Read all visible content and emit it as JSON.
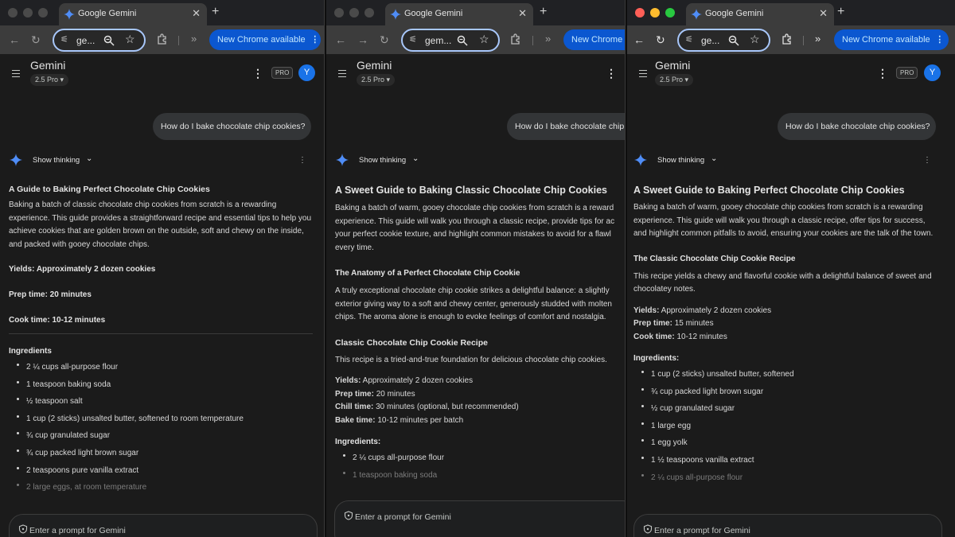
{
  "windows": [
    {
      "tab_title": "Google Gemini",
      "omnibox_text": "ge...",
      "update_label": "New Chrome available",
      "app_title": "Gemini",
      "model": "2.5 Pro",
      "pro_badge": "PRO",
      "avatar_initial": "Y",
      "user_message": "How do I bake chocolate chip cookies?",
      "show_thinking": "Show thinking",
      "heading": "A Guide to Baking Perfect Chocolate Chip Cookies",
      "intro": "Baking a batch of classic chocolate chip cookies from scratch is a rewarding experience. This guide provides a straightforward recipe and essential tips to help you achieve cookies that are golden brown on the outside, soft and chewy on the inside, and packed with gooey chocolate chips.",
      "yields": "Yields: Approximately 2 dozen cookies",
      "prep": "Prep time: 20 minutes",
      "cook": "Cook time: 10-12 minutes",
      "ingredients_heading": "Ingredients",
      "ingredients": [
        "2 ¼ cups all-purpose flour",
        "1 teaspoon baking soda",
        "½ teaspoon salt",
        "1 cup (2 sticks) unsalted butter, softened to room temperature",
        "¾ cup granulated sugar",
        "¾ cup packed light brown sugar",
        "2 teaspoons pure vanilla extract",
        "2 large eggs, at room temperature"
      ],
      "prompt_placeholder": "Enter a prompt for Gemini"
    },
    {
      "tab_title": "Google Gemini",
      "omnibox_text": "gem...",
      "update_label": "New Chrome",
      "app_title": "Gemini",
      "model": "2.5 Pro",
      "user_message": "How do I bake chocolate chip",
      "show_thinking": "Show thinking",
      "heading": "A Sweet Guide to Baking Classic Chocolate Chip Cookies",
      "intro_lines": [
        "Baking a batch of warm, gooey chocolate chip cookies from scratch is a reward",
        "experience. This guide will walk you through a classic recipe, provide tips for ac",
        "your perfect cookie texture, and highlight common mistakes to avoid for a flawl",
        "every time."
      ],
      "anatomy_heading": "The Anatomy of a Perfect Chocolate Chip Cookie",
      "anatomy_lines": [
        "A truly exceptional chocolate chip cookie strikes a delightful balance: a slightly",
        "exterior giving way to a soft and chewy center, generously studded with molten",
        "chips. The aroma alone is enough to evoke feelings of comfort and nostalgia."
      ],
      "recipe_heading": "Classic Chocolate Chip Cookie Recipe",
      "recipe_intro": "This recipe is a tried-and-true foundation for delicious chocolate chip cookies.",
      "yields_label": "Yields:",
      "yields_value": "Approximately 2 dozen cookies",
      "prep_label": "Prep time:",
      "prep_value": "20 minutes",
      "chill_label": "Chill time:",
      "chill_value": "30 minutes (optional, but recommended)",
      "bake_label": "Bake time:",
      "bake_value": "10-12 minutes per batch",
      "ingredients_heading": "Ingredients:",
      "ingredients": [
        "2 ¼ cups all-purpose flour",
        "1 teaspoon baking soda"
      ],
      "prompt_placeholder": "Enter a prompt for Gemini"
    },
    {
      "tab_title": "Google Gemini",
      "omnibox_text": "ge...",
      "update_label": "New Chrome available",
      "app_title": "Gemini",
      "model": "2.5 Pro",
      "pro_badge": "PRO",
      "avatar_initial": "Y",
      "user_message": "How do I bake chocolate chip cookies?",
      "show_thinking": "Show thinking",
      "heading": "A Sweet Guide to Baking Perfect Chocolate Chip Cookies",
      "intro": "Baking a batch of warm, gooey chocolate chip cookies from scratch is a rewarding experience. This guide will walk you through a classic recipe, offer tips for success, and highlight common pitfalls to avoid, ensuring your cookies are the talk of the town.",
      "recipe_heading": "The Classic Chocolate Chip Cookie Recipe",
      "recipe_intro": "This recipe yields a chewy and flavorful cookie with a delightful balance of sweet and chocolatey notes.",
      "yields_label": "Yields:",
      "yields_value": "Approximately 2 dozen cookies",
      "prep_label": "Prep time:",
      "prep_value": "15 minutes",
      "cook_label": "Cook time:",
      "cook_value": "10-12 minutes",
      "ingredients_heading": "Ingredients:",
      "ingredients": [
        "1 cup (2 sticks) unsalted butter, softened",
        "¾ cup packed light brown sugar",
        "½ cup granulated sugar",
        "1 large egg",
        "1 egg yolk",
        "1 ½ teaspoons vanilla extract",
        "2 ¼ cups all-purpose flour"
      ],
      "prompt_placeholder": "Enter a prompt for Gemini"
    }
  ],
  "colors": {
    "background": "#1b1b1b",
    "toolbar": "#3c3c3c",
    "update_button": "#0b57d0",
    "omnibox_border": "#a8c7fa",
    "avatar": "#1a73e8",
    "traffic_red": "#ff5f57",
    "traffic_yellow": "#febc2e",
    "traffic_green": "#28c840"
  },
  "icons": [
    "gemini-favicon",
    "close-icon",
    "plus-icon",
    "back-arrow-icon",
    "forward-arrow-icon",
    "reload-icon",
    "tune-icon",
    "zoom-icon",
    "star-icon",
    "extensions-icon",
    "chevron-double-icon",
    "kebab-icon",
    "menu-icon",
    "gemini-spark-icon",
    "chevron-down-icon",
    "shield-icon"
  ]
}
